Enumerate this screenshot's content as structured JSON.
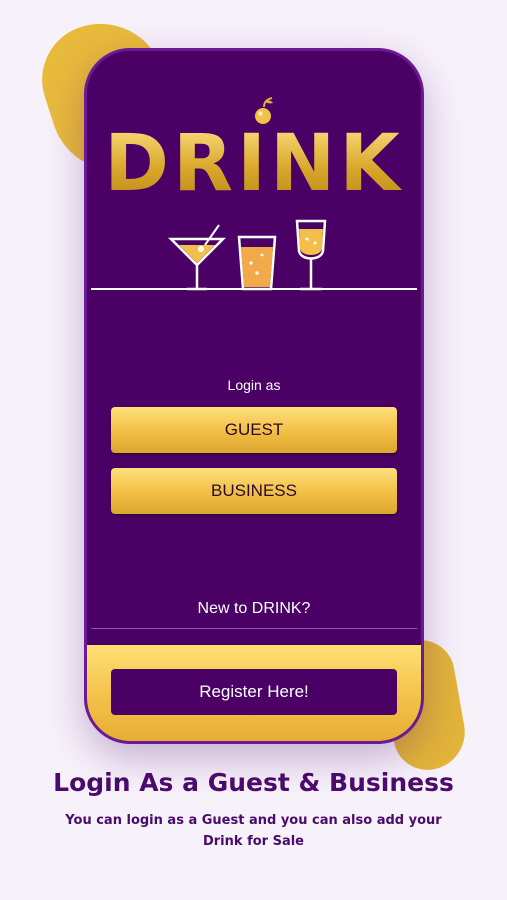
{
  "app": {
    "logo_text": "DRINK"
  },
  "login": {
    "prompt": "Login as",
    "guest_label": "GUEST",
    "business_label": "BUSINESS"
  },
  "register": {
    "prompt": "New to DRINK?",
    "button_label": "Register Here!"
  },
  "caption": {
    "title": "Login As a Guest & Business",
    "subtitle": "You can login as a Guest and you can also add your Drink for Sale"
  },
  "colors": {
    "primary_purple": "#4a0065",
    "gold": "#f2be43",
    "background": "#f7f1fa",
    "caption_text": "#4a0b6b"
  },
  "icons": [
    "cherry-icon",
    "martini-glass-icon",
    "juice-glass-icon",
    "wine-glass-icon"
  ]
}
